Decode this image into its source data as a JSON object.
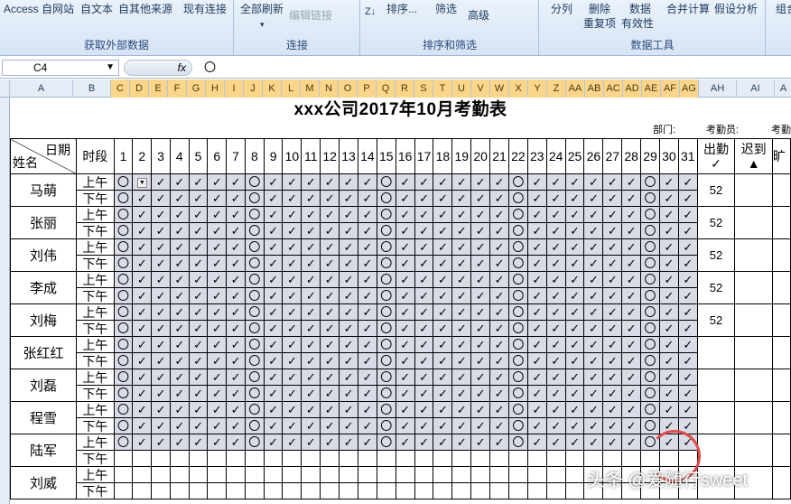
{
  "ribbon": {
    "ext": {
      "items": [
        "Access",
        "自网站",
        "自文本",
        "自其他来源",
        "现有连接"
      ],
      "group": "获取外部数据"
    },
    "conn": {
      "refresh": "全部刷新",
      "edit_links": "编辑链接",
      "group": "连接"
    },
    "sort": {
      "sort": "排序...",
      "filter": "筛选",
      "advanced": "高级",
      "group": "排序和筛选"
    },
    "tools": {
      "text_to_cols": "分列",
      "remove_dup_1": "删除",
      "remove_dup_2": "重复项",
      "validation_1": "数据",
      "validation_2": "有效性",
      "consolidate": "合并计算",
      "whatif": "假设分析",
      "group": "数据工具"
    },
    "outline": {
      "label": "组合"
    }
  },
  "formula_bar": {
    "name_box": "C4",
    "fx": "fx",
    "value": "〇"
  },
  "columns": [
    "A",
    "B",
    "C",
    "D",
    "E",
    "F",
    "G",
    "H",
    "I",
    "J",
    "K",
    "L",
    "M",
    "N",
    "O",
    "P",
    "Q",
    "R",
    "S",
    "T",
    "U",
    "V",
    "W",
    "X",
    "Y",
    "Z",
    "AA",
    "AB",
    "AC",
    "AD",
    "AE",
    "AF",
    "AG",
    "AH",
    "AI",
    "A"
  ],
  "sheet": {
    "title": "xxx公司2017年10月考勤表",
    "dept_label": "部门:",
    "clerk_label": "考勤员:",
    "clerk_label2": "考勤",
    "hdr_date": "日期",
    "hdr_name": "姓名",
    "hdr_period": "时段",
    "days": [
      "1",
      "2",
      "3",
      "4",
      "5",
      "6",
      "7",
      "8",
      "9",
      "10",
      "11",
      "12",
      "13",
      "14",
      "15",
      "16",
      "17",
      "18",
      "19",
      "20",
      "21",
      "22",
      "23",
      "24",
      "25",
      "26",
      "27",
      "28",
      "29",
      "30",
      "31"
    ],
    "hdr_attend": "出勤",
    "hdr_attend_sym": "✓",
    "hdr_late": "迟到",
    "hdr_late_sym": "▲",
    "hdr_next": "旷",
    "am": "上午",
    "pm": "下午",
    "sym_present": "✓",
    "sym_rest": "〇",
    "rest_days": [
      "1",
      "8",
      "15",
      "22",
      "29"
    ],
    "employees": [
      {
        "name": "马萌",
        "count": "52"
      },
      {
        "name": "张丽",
        "count": "52"
      },
      {
        "name": "刘伟",
        "count": "52"
      },
      {
        "name": "李成",
        "count": "52"
      },
      {
        "name": "刘梅",
        "count": "52"
      },
      {
        "name": "张红红",
        "count": ""
      },
      {
        "name": "刘磊",
        "count": ""
      },
      {
        "name": "程雪",
        "count": ""
      },
      {
        "name": "陆军",
        "count": ""
      },
      {
        "name": "刘威",
        "count": ""
      }
    ],
    "filled_rows": 9,
    "partial_row": {
      "index": 8,
      "filled_half": "am"
    }
  },
  "watermark": "头条 @爱随行sweet",
  "colors": {
    "selected_header": "#fbd68a",
    "attendance_fill": "#d9dbe7",
    "ribbon": "#dbe7f6"
  }
}
